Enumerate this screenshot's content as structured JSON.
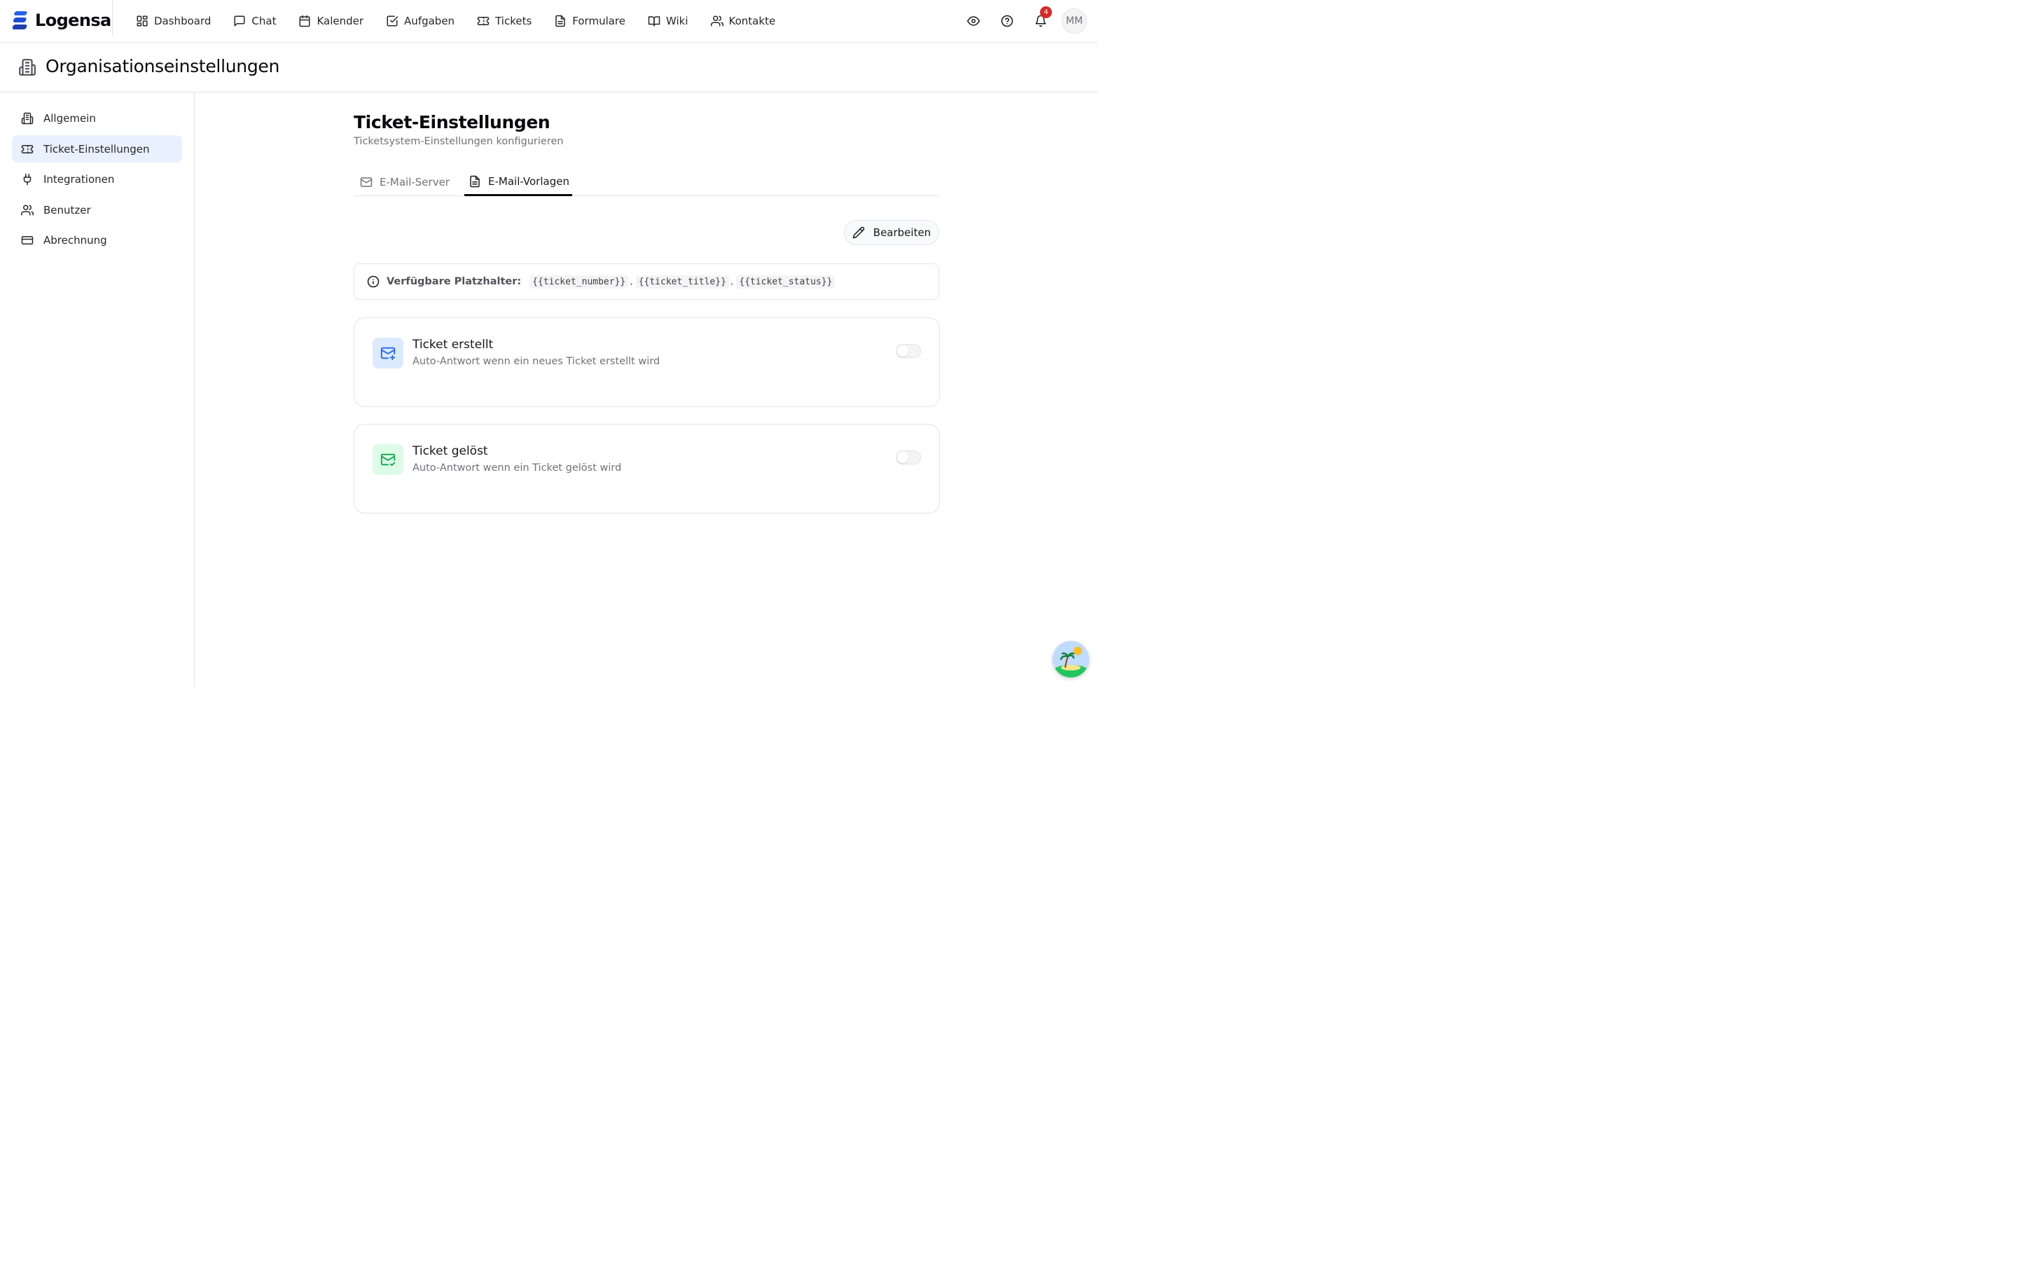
{
  "brand": {
    "name": "Logensa",
    "color": "#1a73e8"
  },
  "nav": {
    "items": [
      {
        "label": "Dashboard",
        "icon": "dashboard-icon"
      },
      {
        "label": "Chat",
        "icon": "chat-icon"
      },
      {
        "label": "Kalender",
        "icon": "calendar-icon"
      },
      {
        "label": "Aufgaben",
        "icon": "task-icon"
      },
      {
        "label": "Tickets",
        "icon": "ticket-icon"
      },
      {
        "label": "Formulare",
        "icon": "form-icon"
      },
      {
        "label": "Wiki",
        "icon": "book-icon"
      },
      {
        "label": "Kontakte",
        "icon": "contacts-icon"
      }
    ],
    "notification_count": "4",
    "avatar_initials": "MM"
  },
  "page": {
    "title": "Organisationseinstellungen"
  },
  "sidebar": {
    "items": [
      {
        "label": "Allgemein",
        "icon": "building-icon",
        "active": false
      },
      {
        "label": "Ticket-Einstellungen",
        "icon": "ticket-icon",
        "active": true
      },
      {
        "label": "Integrationen",
        "icon": "plug-icon",
        "active": false
      },
      {
        "label": "Benutzer",
        "icon": "users-icon",
        "active": false
      },
      {
        "label": "Abrechnung",
        "icon": "credit-card-icon",
        "active": false
      }
    ]
  },
  "main": {
    "title": "Ticket-Einstellungen",
    "subtitle": "Ticketsystem-Einstellungen konfigurieren",
    "tabs": [
      {
        "label": "E-Mail-Server",
        "icon": "mail-icon",
        "active": false
      },
      {
        "label": "E-Mail-Vorlagen",
        "icon": "file-text-icon",
        "active": true
      }
    ],
    "edit_label": "Bearbeiten",
    "placeholders": {
      "label": "Verfügbare Platzhalter:",
      "codes": [
        "{{ticket_number}}",
        "{{ticket_title}}",
        "{{ticket_status}}"
      ],
      "separator": ","
    },
    "cards": [
      {
        "title": "Ticket erstellt",
        "description": "Auto-Antwort wenn ein neues Ticket erstellt wird",
        "icon": "mail-plus-icon",
        "icon_bg": "#dbeafe",
        "icon_color": "#2563eb",
        "enabled": false
      },
      {
        "title": "Ticket gelöst",
        "description": "Auto-Antwort wenn ein Ticket gelöst wird",
        "icon": "mail-check-icon",
        "icon_bg": "#dcfce7",
        "icon_color": "#16a34a",
        "enabled": false
      }
    ]
  }
}
